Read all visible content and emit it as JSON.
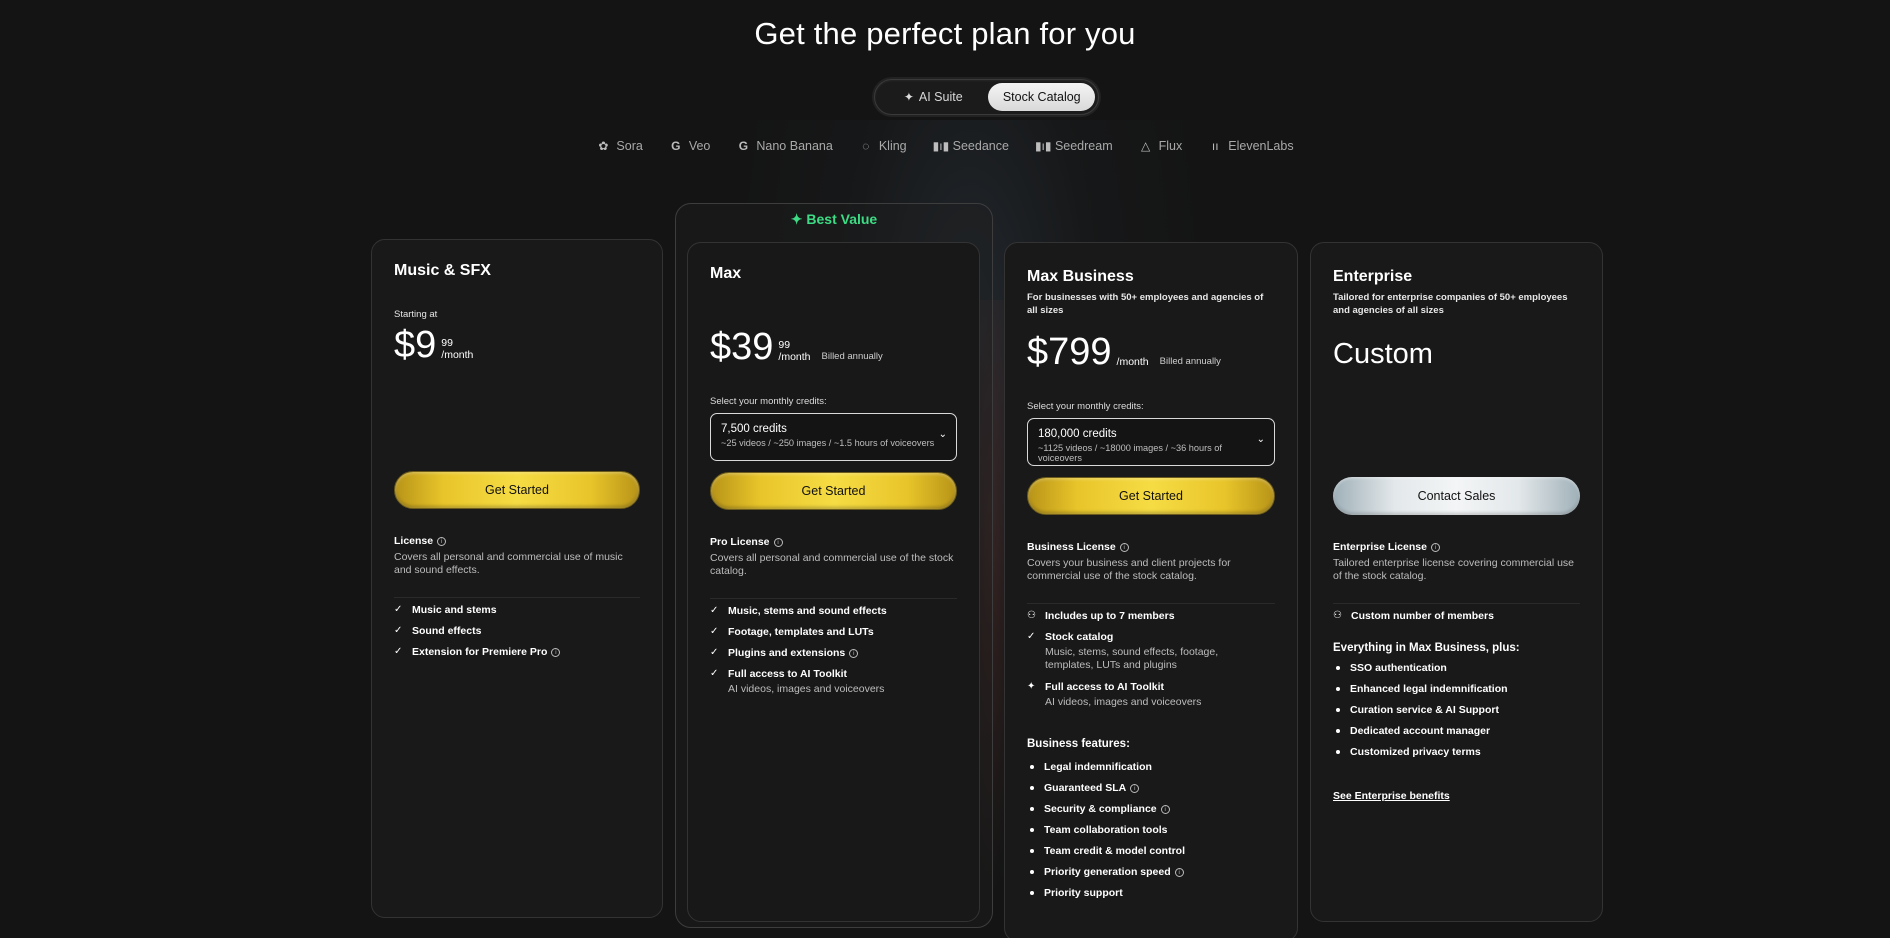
{
  "heading": "Get the perfect plan for you",
  "toggle": {
    "ai_suite": "AI Suite",
    "stock_catalog": "Stock Catalog"
  },
  "models": [
    {
      "label": "Sora",
      "icon": "openai-icon"
    },
    {
      "label": "Veo",
      "icon": "google-icon"
    },
    {
      "label": "Nano Banana",
      "icon": "google-icon"
    },
    {
      "label": "Kling",
      "icon": "kling-icon"
    },
    {
      "label": "Seedance",
      "icon": "bars-icon"
    },
    {
      "label": "Seedream",
      "icon": "bars-icon"
    },
    {
      "label": "Flux",
      "icon": "flux-icon"
    },
    {
      "label": "ElevenLabs",
      "icon": "elevenlabs-icon"
    }
  ],
  "best_value": "✦ Best Value",
  "plans": {
    "music": {
      "title": "Music & SFX",
      "starting": "Starting at",
      "price": "$9",
      "cents": "99",
      "period": "/month",
      "cta": "Get Started",
      "license_title": "License",
      "license_desc": "Covers all personal and commercial use of music and sound effects.",
      "features": [
        "Music and stems",
        "Sound effects",
        "Extension for Premiere Pro"
      ]
    },
    "max": {
      "title": "Max",
      "price": "$39",
      "cents": "99",
      "period": "/month",
      "billed": "Billed annually",
      "select_label": "Select your monthly credits:",
      "credits": "7,500 credits",
      "credits_sub": "~25 videos / ~250 images / ~1.5 hours of voiceovers",
      "cta": "Get Started",
      "license_title": "Pro License",
      "license_desc": "Covers all personal and commercial use of the stock catalog.",
      "features": [
        "Music, stems and sound effects",
        "Footage, templates and LUTs",
        "Plugins and extensions",
        "Full access to AI Toolkit"
      ],
      "feature_sub": "AI videos, images and voiceovers"
    },
    "business": {
      "title": "Max Business",
      "subtitle": "For businesses with 50+ employees and agencies of all sizes",
      "price": "$799",
      "period": "/month",
      "billed": "Billed annually",
      "select_label": "Select your monthly credits:",
      "credits": "180,000 credits",
      "credits_sub": "~1125 videos / ~18000 images / ~36 hours of voiceovers",
      "cta": "Get Started",
      "license_title": "Business License",
      "license_desc": "Covers your business and client projects for commercial use of the stock catalog.",
      "f_members": "Includes up to 7 members",
      "f_stock": "Stock catalog",
      "f_stock_sub": "Music, stems, sound effects, footage, templates, LUTs and plugins",
      "f_ai": "Full access to AI Toolkit",
      "f_ai_sub": "AI videos, images and voiceovers",
      "bf_title": "Business features:",
      "bf": [
        "Legal indemnification",
        "Guaranteed SLA",
        "Security & compliance",
        "Team collaboration tools",
        "Team credit & model control",
        "Priority generation speed",
        "Priority support"
      ]
    },
    "enterprise": {
      "title": "Enterprise",
      "subtitle": "Tailored for enterprise companies of 50+ employees and agencies of all sizes",
      "price": "Custom",
      "cta": "Contact Sales",
      "license_title": "Enterprise License",
      "license_desc": "Tailored enterprise license covering commercial use of the stock catalog.",
      "members": "Custom number of members",
      "plus_title": "Everything in Max Business, plus:",
      "plus": [
        "SSO authentication",
        "Enhanced legal indemnification",
        "Curation service & AI Support",
        "Dedicated account manager",
        "Customized privacy terms"
      ],
      "link": "See Enterprise benefits"
    }
  }
}
